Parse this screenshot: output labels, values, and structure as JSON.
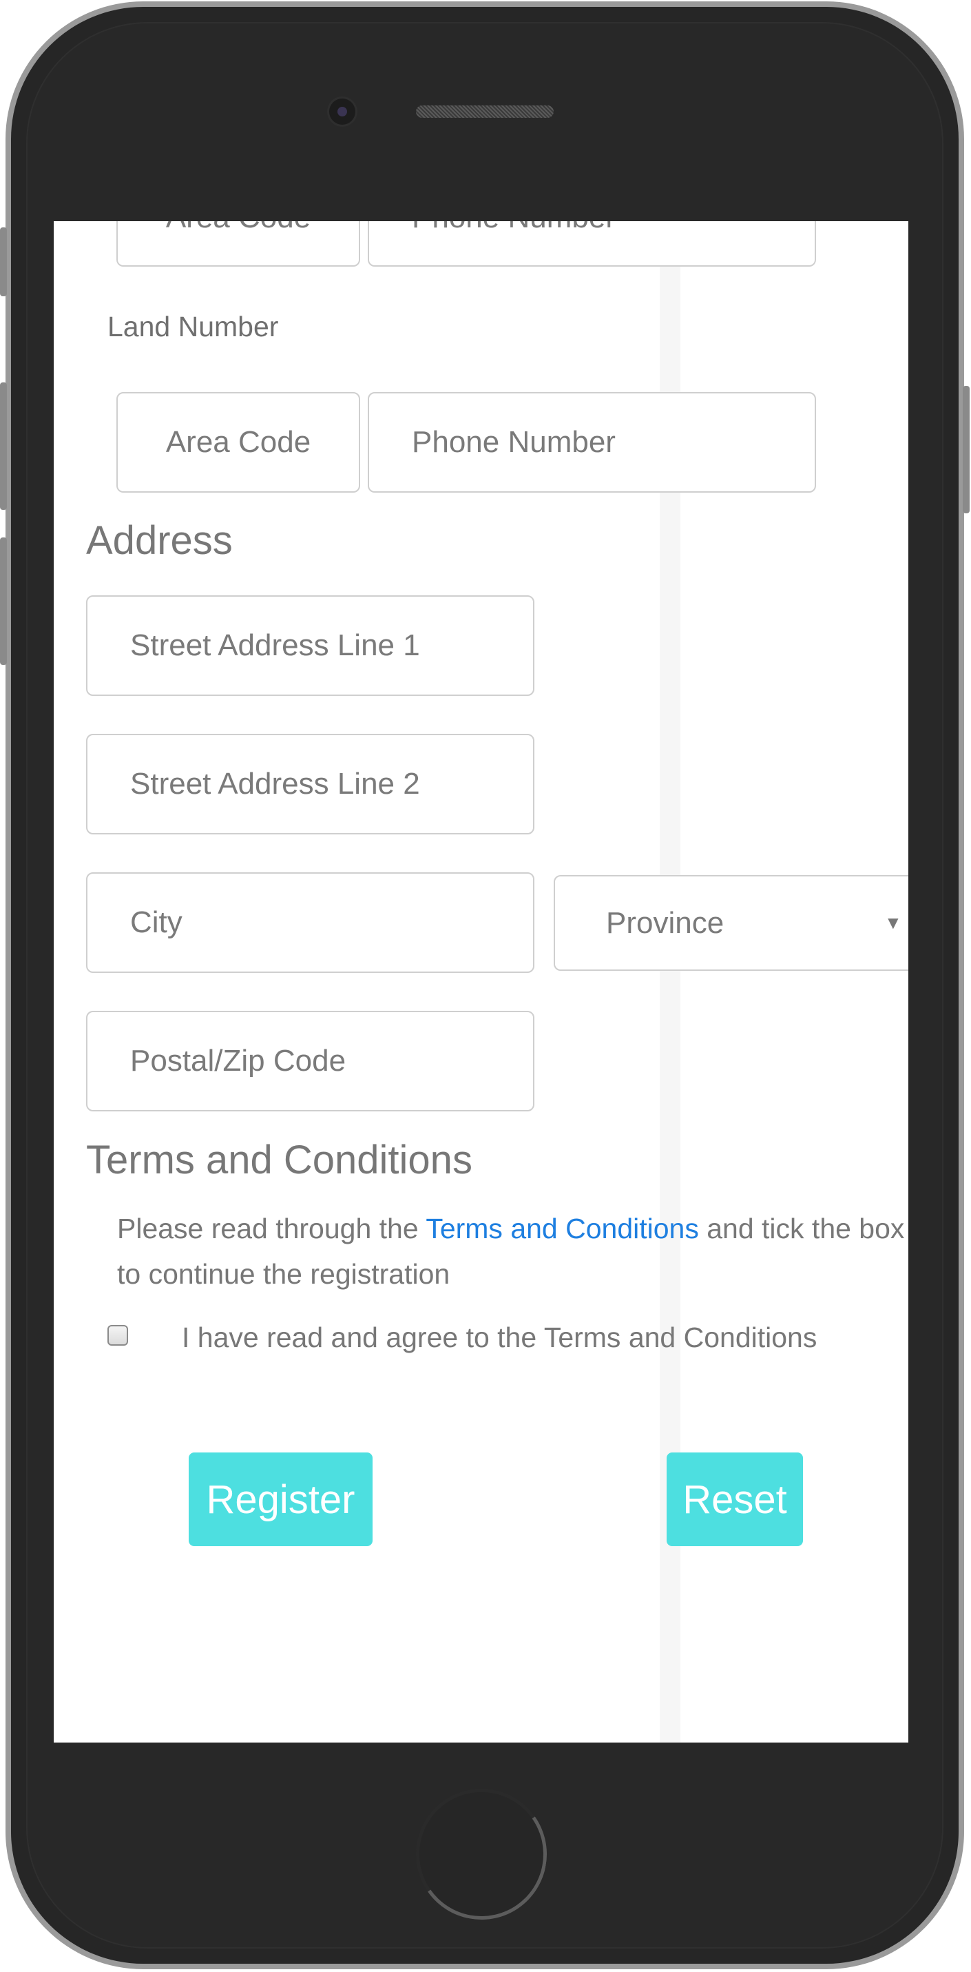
{
  "top_row": {
    "area_code_placeholder": "Area Code",
    "phone_number_placeholder": "Phone Number"
  },
  "land_number": {
    "label": "Land Number",
    "area_code_placeholder": "Area Code",
    "phone_number_placeholder": "Phone Number"
  },
  "address": {
    "heading": "Address",
    "street1_placeholder": "Street Address Line 1",
    "street2_placeholder": "Street Address Line 2",
    "city_placeholder": "City",
    "province_selected": "Province",
    "postal_placeholder": "Postal/Zip Code"
  },
  "terms": {
    "heading": "Terms and Conditions",
    "text_before": "Please read through the ",
    "link_text": "Terms and Conditions",
    "text_after": " and tick the box to continue the registration",
    "checkbox_label": "I have read and agree to the Terms and Conditions"
  },
  "buttons": {
    "register": "Register",
    "reset": "Reset"
  },
  "colors": {
    "accent": "#4ddfe0",
    "link": "#1e7fe0",
    "text": "#777777"
  },
  "icons": {
    "dropdown": "caret-down-icon"
  }
}
